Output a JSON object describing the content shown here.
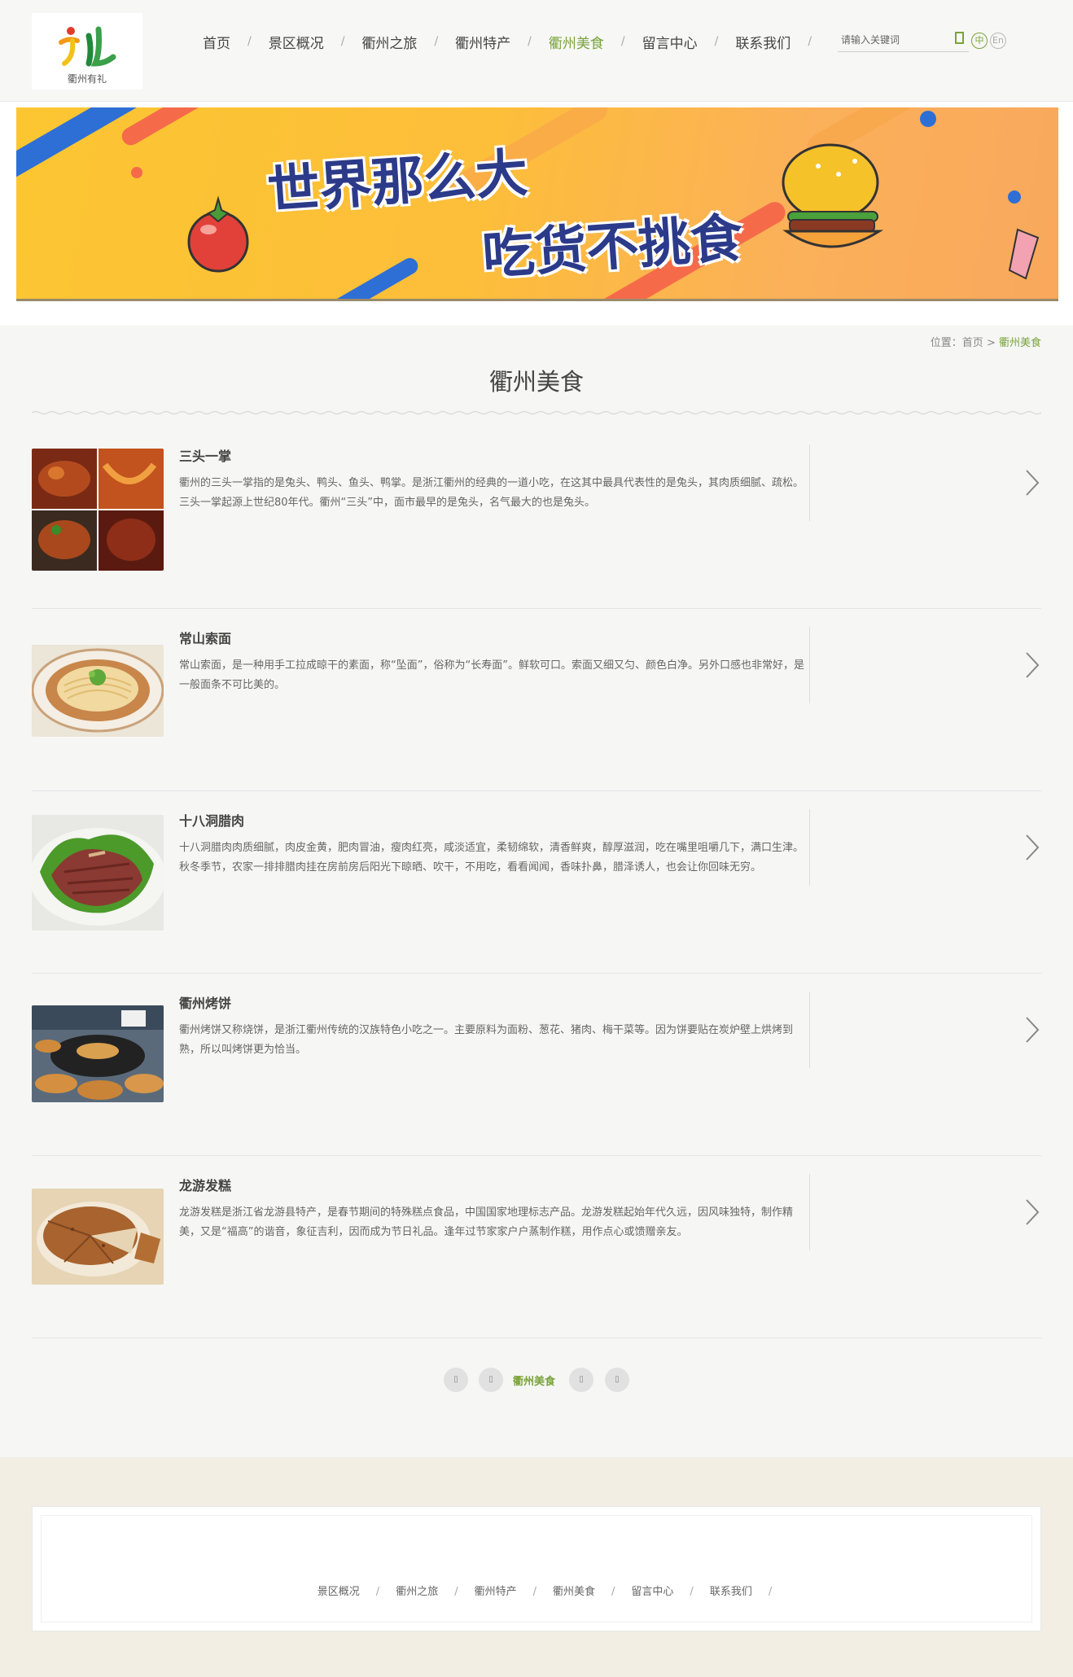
{
  "header": {
    "logo_text": "衢州有礼",
    "nav": [
      {
        "label": "首页",
        "active": false
      },
      {
        "label": "景区概况",
        "active": false
      },
      {
        "label": "衢州之旅",
        "active": false
      },
      {
        "label": "衢州特产",
        "active": false
      },
      {
        "label": "衢州美食",
        "active": true
      },
      {
        "label": "留言中心",
        "active": false
      },
      {
        "label": "联系我们",
        "active": false
      }
    ],
    "search_placeholder": "请输入关键词",
    "lang_zh": "中",
    "lang_en": "En"
  },
  "banner": {
    "line1": "世界那么大",
    "line2": "吃货不挑食"
  },
  "breadcrumb": {
    "prefix": "位置：",
    "home": "首页",
    "sep": ">",
    "current": "衢州美食"
  },
  "page_title": "衢州美食",
  "items": [
    {
      "title": "三头一掌",
      "desc": "衢州的三头一掌指的是兔头、鸭头、鱼头、鸭掌。是浙江衢州的经典的一道小吃，在这其中最具代表性的是兔头，其肉质细腻、疏松。三头一掌起源上世纪80年代。衢州“三头”中，面市最早的是兔头，名气最大的也是兔头。"
    },
    {
      "title": "常山索面",
      "desc": "常山索面，是一种用手工拉成晾干的素面，称“坠面”，俗称为“长寿面”。鲜软可口。索面又细又匀、颜色白净。另外口感也非常好，是一般面条不可比美的。"
    },
    {
      "title": "十八洞腊肉",
      "desc": "十八洞腊肉肉质细腻，肉皮金黄，肥肉冒油，瘦肉红亮，咸淡适宜，柔韧绵软，清香鲜爽，醇厚滋润，吃在嘴里咀嚼几下，满口生津。秋冬季节，农家一排排腊肉挂在房前房后阳光下晾晒、吹干，不用吃，看看闻闻，香味扑鼻，腊泽诱人，也会让你回味无穷。"
    },
    {
      "title": "衢州烤饼",
      "desc": "衢州烤饼又称烧饼，是浙江衢州传统的汉族特色小吃之一。主要原料为面粉、葱花、猪肉、梅干菜等。因为饼要贴在炭炉壁上烘烤到熟，所以叫烤饼更为恰当。"
    },
    {
      "title": "龙游发糕",
      "desc": "龙游发糕是浙江省龙游县特产，是春节期间的特殊糕点食品，中国国家地理标志产品。龙游发糕起始年代久远，因风味独特，制作精美，又是“福高”的谐音，象征吉利，因而成为节日礼品。逢年过节家家户户蒸制作糕，用作点心或馈赠亲友。"
    }
  ],
  "pager": {
    "current": "衢州美食",
    "btn_glyph": "▯"
  },
  "footer": {
    "nav": [
      "景区概况",
      "衢州之旅",
      "衢州特产",
      "衢州美食",
      "留言中心",
      "联系我们"
    ],
    "sep": "/"
  },
  "colors": {
    "accent": "#7aa33c",
    "text": "#444444"
  }
}
